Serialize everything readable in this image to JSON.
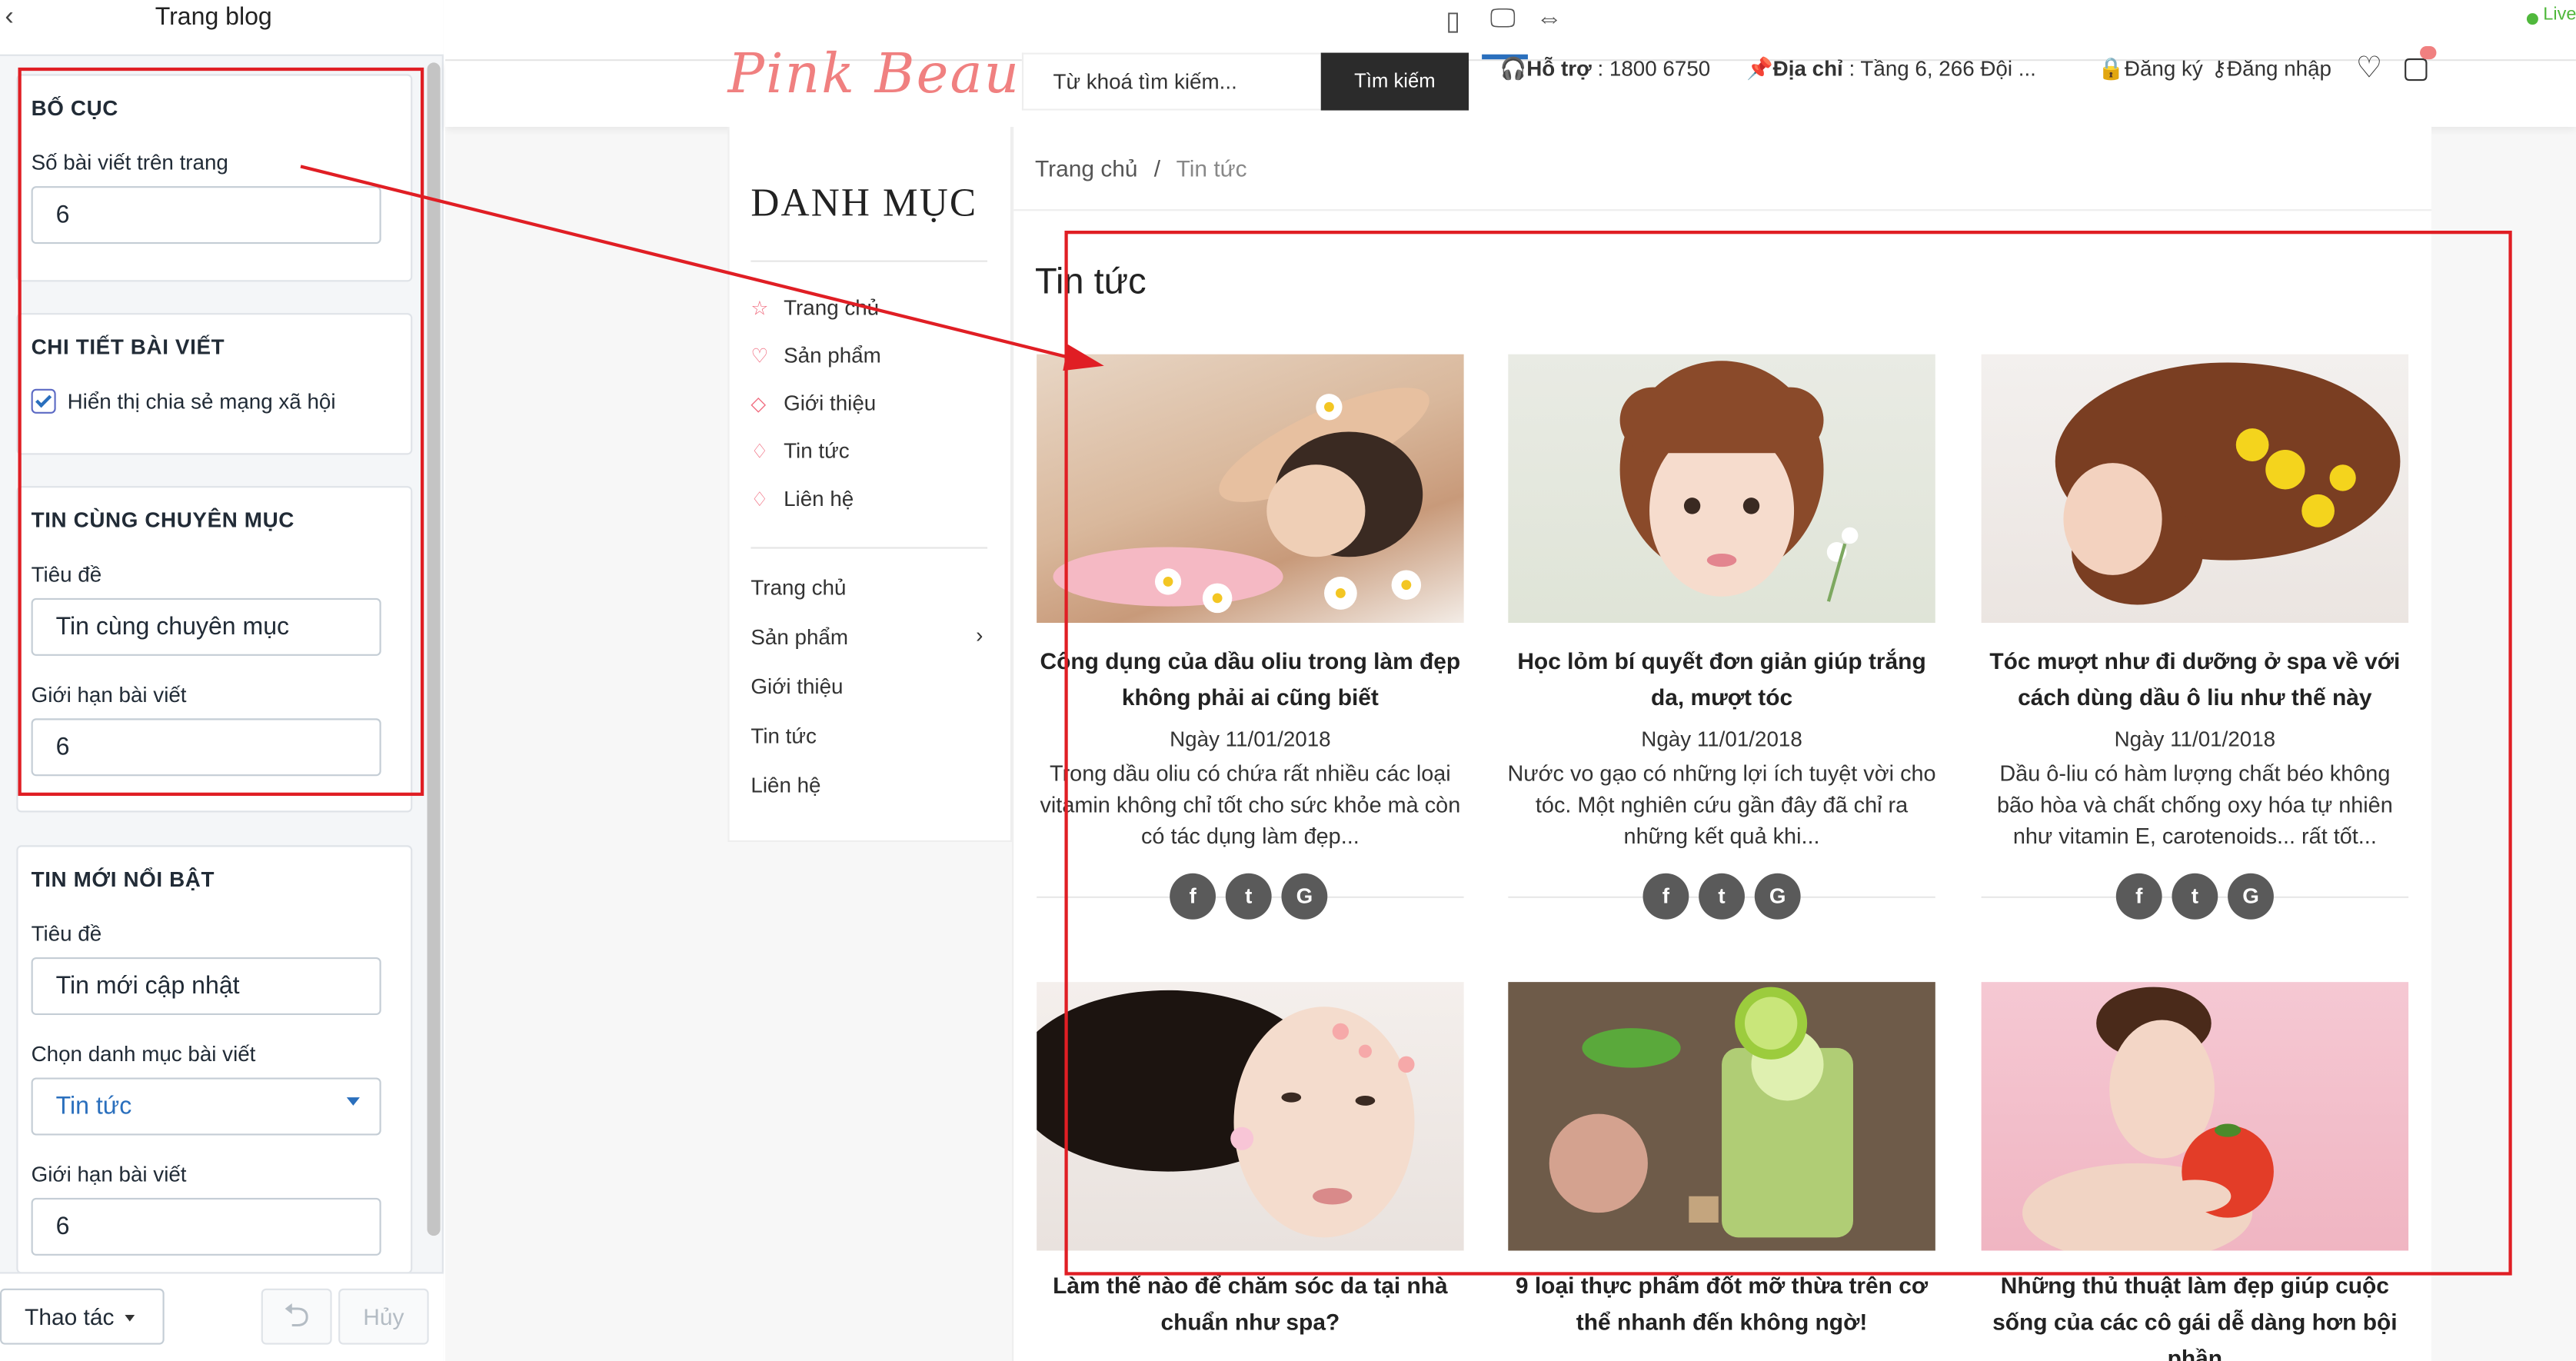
{
  "panel": {
    "title": "Trang blog",
    "layout": {
      "heading": "BỐ CỤC",
      "posts_per_page_label": "Số bài viết trên trang",
      "posts_per_page_value": "6"
    },
    "post_detail": {
      "heading": "CHI TIẾT BÀI VIẾT",
      "show_share_label": "Hiển thị chia sẻ mạng xã hội",
      "show_share_checked": true
    },
    "related": {
      "heading": "TIN CÙNG CHUYÊN MỤC",
      "title_label": "Tiêu đề",
      "title_value": "Tin cùng chuyên mục",
      "limit_label": "Giới hạn bài viết",
      "limit_value": "6"
    },
    "featured": {
      "heading": "TIN MỚI NỔI BẬT",
      "title_label": "Tiêu đề",
      "title_value": "Tin mới cập nhật",
      "category_label": "Chọn danh mục bài viết",
      "category_value": "Tin tức",
      "limit_label": "Giới hạn bài viết",
      "limit_value": "6"
    },
    "footer": {
      "actions_label": "Thao tác",
      "undo_label": "⮌",
      "cancel_label": "Hủy"
    }
  },
  "editor_bar": {
    "live_label": "Live"
  },
  "site": {
    "logo_text": "Pink Beauty",
    "search_placeholder": "Từ khoá tìm kiếm...",
    "search_button": "Tìm kiếm",
    "support_label": "Hỗ trợ",
    "support_value": " : 1800 6750",
    "address_label": "Địa chỉ",
    "address_value": " : Tầng 6, 266 Đội ...",
    "register_label": "Đăng ký",
    "login_label": "Đăng nhập",
    "sidebar": {
      "title": "DANH MỤC",
      "categories": [
        {
          "label": "Trang chủ",
          "icon": "star-icon"
        },
        {
          "label": "Sản phẩm",
          "icon": "heart-icon"
        },
        {
          "label": "Giới thiệu",
          "icon": "tag-icon"
        },
        {
          "label": "Tin tức",
          "icon": "diamond-icon"
        },
        {
          "label": "Liên hệ",
          "icon": "diamond-icon"
        }
      ],
      "nav": [
        "Trang chủ",
        "Sản phẩm",
        "Giới thiệu",
        "Tin tức",
        "Liên hệ"
      ]
    },
    "breadcrumb": {
      "home": "Trang chủ",
      "separator": "/",
      "current": "Tin tức"
    },
    "page_title": "Tin tức",
    "posts": [
      {
        "title": "Công dụng của dầu oliu trong làm đẹp không phải ai cũng biết",
        "date": "Ngày 11/01/2018",
        "excerpt": "Trong dầu oliu có chứa rất nhiều các loại vitamin không chỉ tốt cho sức khỏe mà còn có tác dụng làm đẹp...",
        "image": "spa-massage-photo"
      },
      {
        "title": "Học lỏm bí quyết đơn giản giúp trắng da, mượt tóc",
        "date": "Ngày 11/01/2018",
        "excerpt": "Nước vo gạo có những lợi ích tuyệt vời cho tóc. Một nghiên cứu gần đây đã chỉ ra những kết quả khi...",
        "image": "girl-flower-photo"
      },
      {
        "title": "Tóc mượt như đi dưỡng ở spa về với cách dùng dầu ô liu như thế này",
        "date": "Ngày 11/01/2018",
        "excerpt": "Dầu ô-liu có hàm lượng chất béo không bão hòa và chất chống oxy hóa tự nhiên như vitamin E, carotenoids... rất tốt...",
        "image": "curly-hair-photo"
      },
      {
        "title": "Làm thế nào để chăm sóc da tại nhà chuẩn như spa?",
        "image": "face-petals-photo"
      },
      {
        "title": "9 loại thực phẩm đốt mỡ thừa trên cơ thể nhanh đến không ngờ!",
        "image": "lime-drink-photo"
      },
      {
        "title": "Những thủ thuật làm đẹp giúp cuộc sống của các cô gái dễ dàng hơn bội phần",
        "image": "tomato-bite-photo"
      }
    ],
    "share_buttons": [
      "f",
      "t",
      "G"
    ]
  },
  "colors": {
    "annotation_red": "#e01e24",
    "accent_pink": "#f06b7e",
    "link_blue": "#2a6fbd"
  }
}
